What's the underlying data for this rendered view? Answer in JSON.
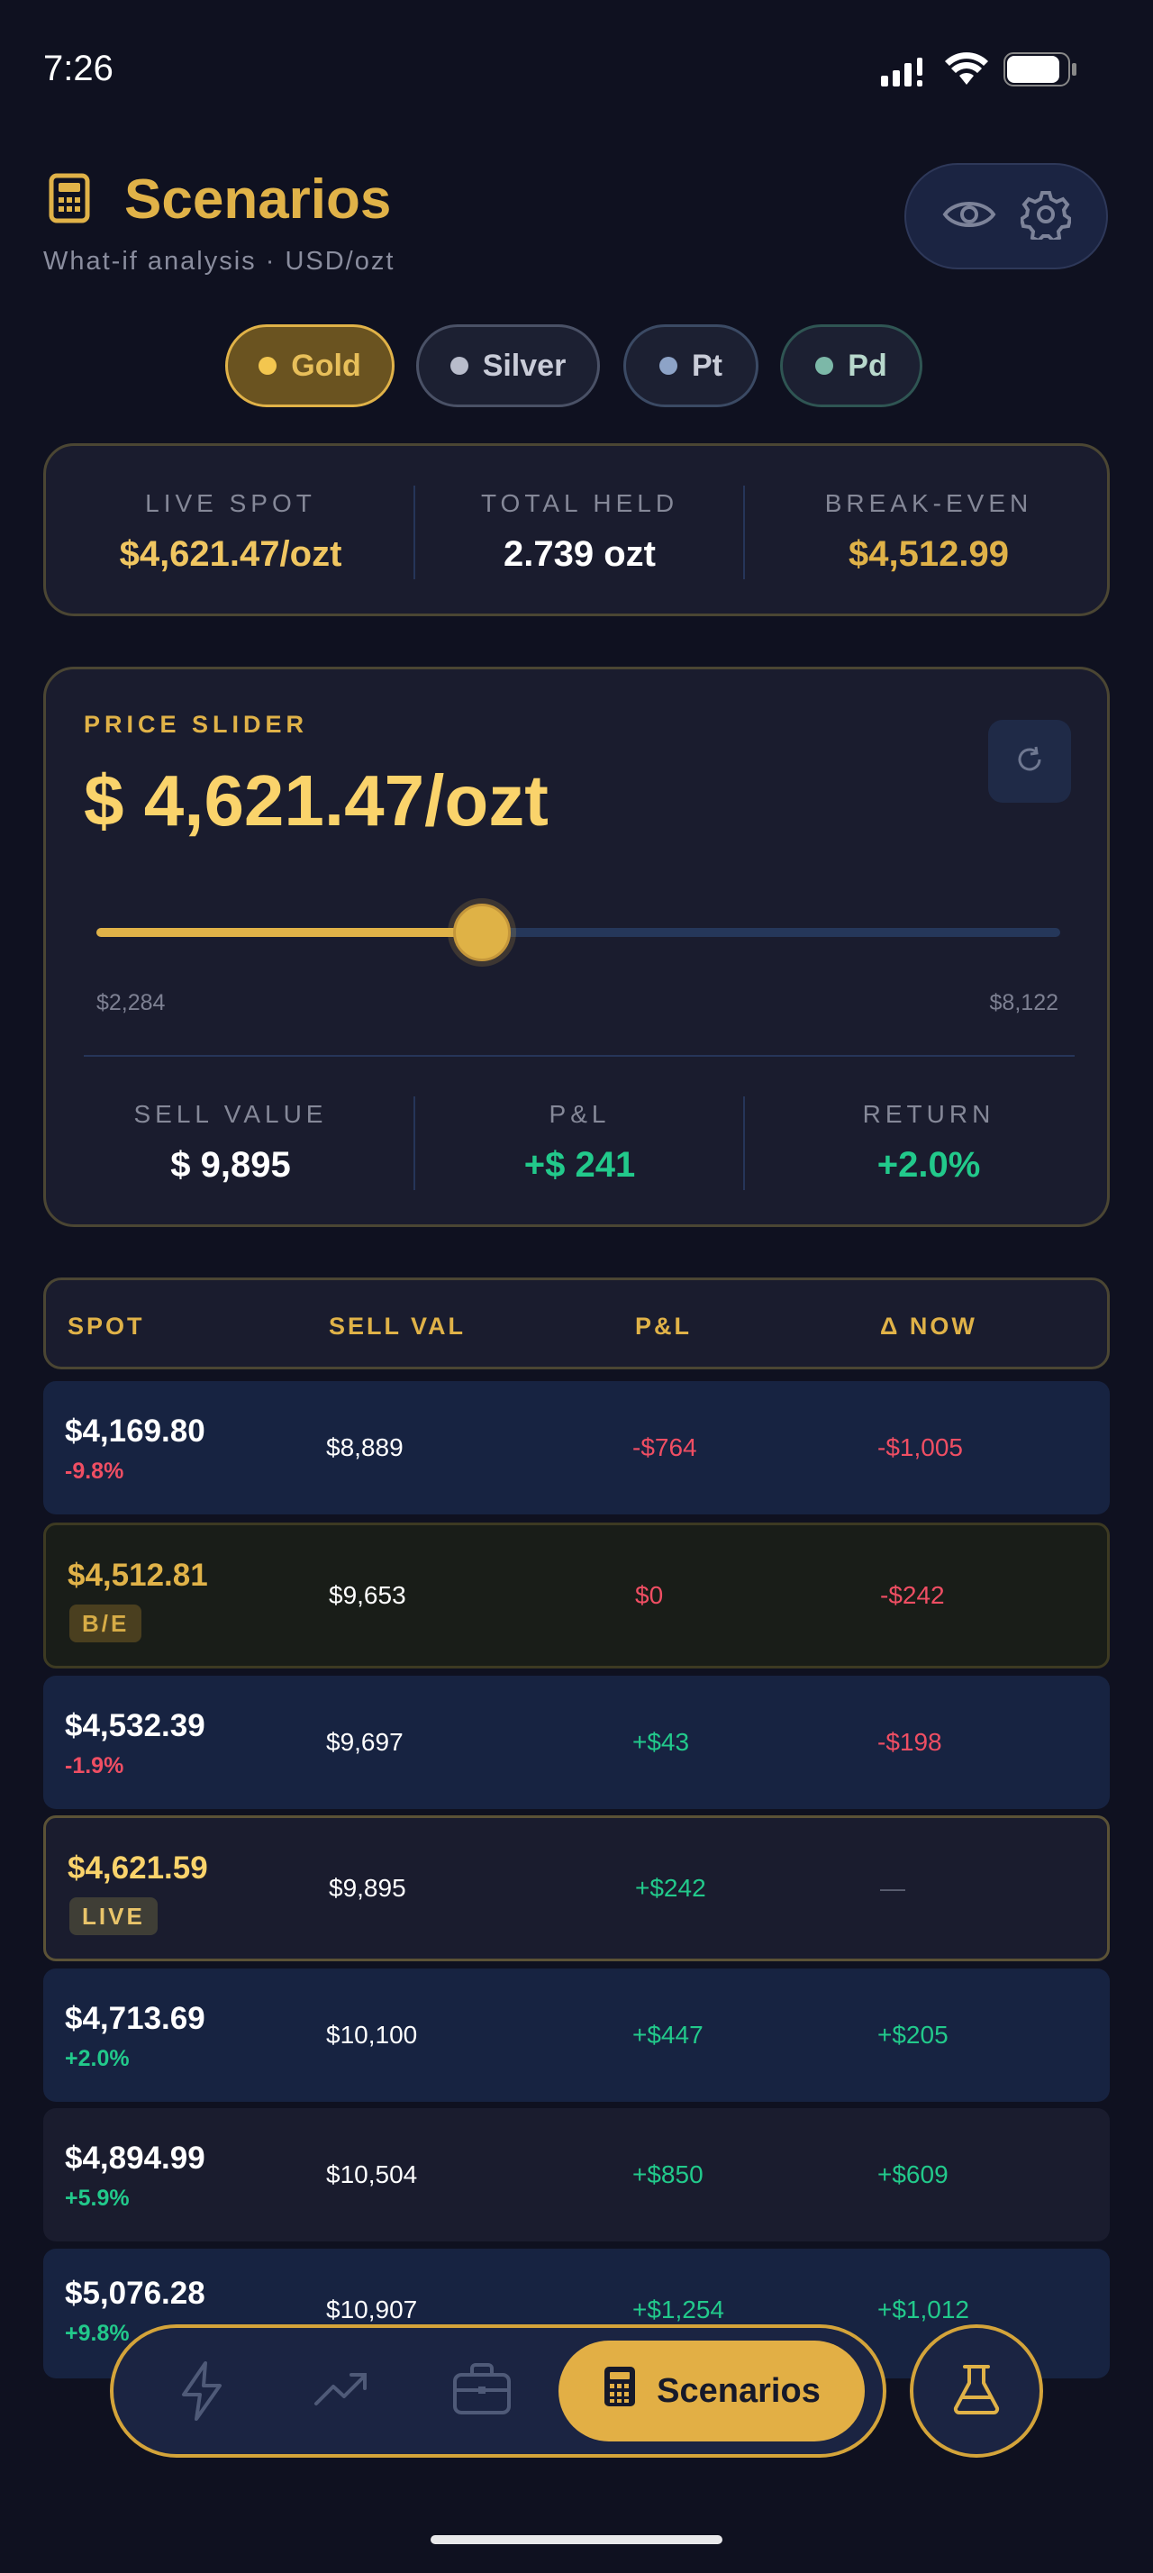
{
  "status": {
    "time": "7:26"
  },
  "header": {
    "title": "Scenarios",
    "subtitle": "What-if analysis  ·  USD/ozt"
  },
  "icons": {
    "header": "calculator-icon",
    "eye": "eye-icon",
    "settings": "gear-icon",
    "reset": "refresh-icon"
  },
  "metals": [
    {
      "label": "Gold",
      "color": "#f3c64f",
      "selected": true
    },
    {
      "label": "Silver",
      "color": "#b8bccb",
      "selected": false
    },
    {
      "label": "Pt",
      "color": "#8da3c7",
      "selected": false
    },
    {
      "label": "Pd",
      "color": "#7cb8a8",
      "selected": false
    }
  ],
  "summary": {
    "spot_label": "LIVE SPOT",
    "spot_value": "$4,621.47/ozt",
    "held_label": "TOTAL HELD",
    "held_value": "2.739 ozt",
    "be_label": "BREAK-EVEN",
    "be_value": "$4,512.99"
  },
  "slider": {
    "label": "PRICE SLIDER",
    "price": "$ 4,621.47/ozt",
    "min_label": "$2,284",
    "max_label": "$8,122",
    "position_fraction": 0.4,
    "sell_label": "SELL VALUE",
    "sell_value": "$ 9,895",
    "pl_label": "P&L",
    "pl_value": "+$ 241",
    "return_label": "RETURN",
    "return_value": "+2.0%"
  },
  "table": {
    "headers": [
      "SPOT",
      "SELL VAL",
      "P&L",
      "Δ NOW"
    ],
    "rows": [
      {
        "spot": "$4,169.80",
        "sub": "-9.8%",
        "sell": "$8,889",
        "pl": "-$764",
        "delta": "-$1,005"
      },
      {
        "spot": "$4,512.81",
        "sub": "B/E",
        "sell": "$9,653",
        "pl": "$0",
        "delta": "-$242"
      },
      {
        "spot": "$4,532.39",
        "sub": "-1.9%",
        "sell": "$9,697",
        "pl": "+$43",
        "delta": "-$198"
      },
      {
        "spot": "$4,621.59",
        "sub": "LIVE",
        "sell": "$9,895",
        "pl": "+$242",
        "delta": "—"
      },
      {
        "spot": "$4,713.69",
        "sub": "+2.0%",
        "sell": "$10,100",
        "pl": "+$447",
        "delta": "+$205"
      },
      {
        "spot": "$4,894.99",
        "sub": "+5.9%",
        "sell": "$10,504",
        "pl": "+$850",
        "delta": "+$609"
      },
      {
        "spot": "$5,076.28",
        "sub": "+9.8%",
        "sell": "$10,907",
        "pl": "+$1,254",
        "delta": "+$1,012"
      }
    ]
  },
  "nav": {
    "items": [
      {
        "icon": "bolt-icon"
      },
      {
        "icon": "trending-icon"
      },
      {
        "icon": "briefcase-icon"
      },
      {
        "icon": "calculator-icon",
        "label": "Scenarios",
        "active": true
      }
    ],
    "side_icon": "flask-icon"
  },
  "colors": {
    "accent": "#e0b248",
    "positive": "#22c98b",
    "negative": "#ef4e63",
    "background": "#0f1120"
  }
}
